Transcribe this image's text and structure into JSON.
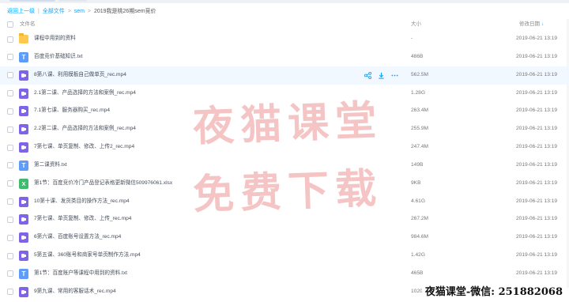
{
  "breadcrumb": {
    "back": "返回上一级",
    "all_files": "全部文件",
    "folder": "sem",
    "current": "2019我是桃26期sem竞价",
    "separator": "|",
    "arrow": ">"
  },
  "columns": {
    "name": "文件名",
    "size": "大小",
    "date": "修改日期"
  },
  "rows": [
    {
      "icon": "folder-icon",
      "name": "课程中用到的资料",
      "size": "-",
      "date": "2019-06-21 13:19"
    },
    {
      "icon": "txt-file-icon",
      "name": "百度竞价基础知识.txt",
      "size": "486B",
      "date": "2019-06-21 13:19"
    },
    {
      "icon": "video-file-icon",
      "name": "8第八课、利用模板自己做单页_rec.mp4",
      "size": "562.5M",
      "date": "2019-06-21 13:19"
    },
    {
      "icon": "video-file-icon",
      "name": "2.1第二课、产品选择的方法和案例_rec.mp4",
      "size": "1.28G",
      "date": "2019-06-21 13:19"
    },
    {
      "icon": "video-file-icon",
      "name": "7.1第七课、服务器购买_rec.mp4",
      "size": "263.4M",
      "date": "2019-06-21 13:19"
    },
    {
      "icon": "video-file-icon",
      "name": "2.2第二课、产品选择的方法和案例_rec.mp4",
      "size": "255.9M",
      "date": "2019-06-21 13:19"
    },
    {
      "icon": "video-file-icon",
      "name": "7第七课、单页复制、修改、上传2_rec.mp4",
      "size": "247.4M",
      "date": "2019-06-21 13:19"
    },
    {
      "icon": "txt-file-icon",
      "name": "第二课资料.txt",
      "size": "149B",
      "date": "2019-06-21 13:19"
    },
    {
      "icon": "excel-file-icon",
      "name": "第1节：百度竞价冷门产品登记表格更新微信509976061.xlsx",
      "size": "9KB",
      "date": "2019-06-21 13:19"
    },
    {
      "icon": "video-file-icon",
      "name": "10第十课、发货类目的操作方法_rec.mp4",
      "size": "4.61G",
      "date": "2019-06-21 13:19"
    },
    {
      "icon": "video-file-icon",
      "name": "7第七课、单页复制、修改、上传_rec.mp4",
      "size": "267.2M",
      "date": "2019-06-21 13:19"
    },
    {
      "icon": "video-file-icon",
      "name": "6第六课、百度账号设置方法_rec.mp4",
      "size": "984.6M",
      "date": "2019-06-21 13:19"
    },
    {
      "icon": "video-file-icon",
      "name": "5第五课、360账号和商家号单页制作方法.mp4",
      "size": "1.42G",
      "date": "2019-06-21 13:19"
    },
    {
      "icon": "txt-file-icon",
      "name": "第1节：百度账户等课程中用到的资料.txt",
      "size": "465B",
      "date": "2019-06-21 13:19"
    },
    {
      "icon": "video-file-icon",
      "name": "9第九课、常用的客服话术_rec.mp4",
      "size": "1020M",
      "date": "2019-06-21 13:19"
    }
  ],
  "hover_row_index": 2,
  "watermark": {
    "line1": "夜猫课堂",
    "line2": "免费下载",
    "color": "#e87474"
  },
  "credit": "夜猫课堂-微信: 251882068",
  "colors": {
    "accent": "#06a7ff",
    "hover_bg": "#f2f8ff",
    "video_icon": "#7f63e9",
    "txt_icon": "#5d9cf9",
    "excel_icon": "#3dbd6c",
    "folder_icon": "#ffc94d"
  }
}
